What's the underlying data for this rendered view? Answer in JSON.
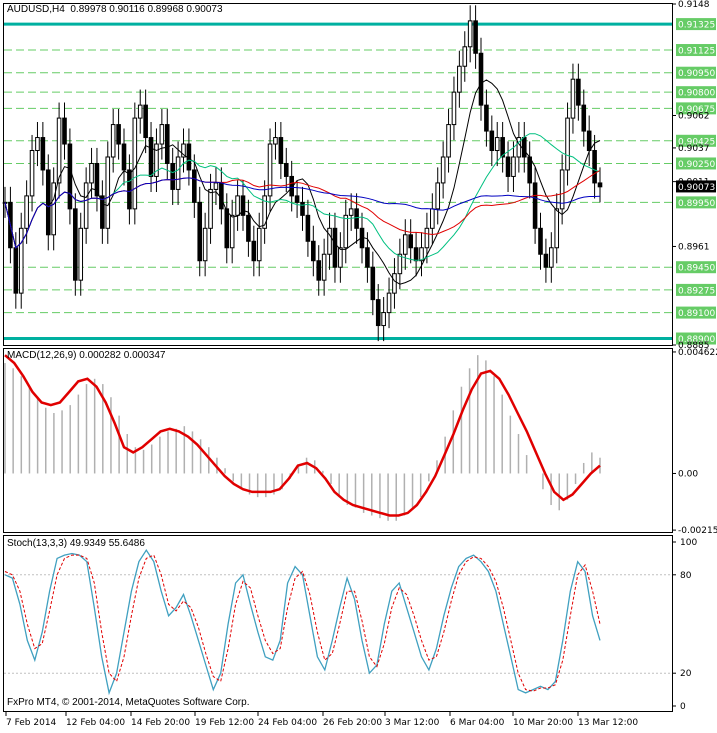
{
  "header": {
    "symbol": "AUDUSD,H4",
    "ohlc": "0.89978 0.90116 0.89968 0.90073"
  },
  "macd_header": "MACD(12,26,9) 0.000282 0.000347",
  "stoch_header": "Stoch(13,3,3) 49.9349 55.6486",
  "copyright": "FxPro MT4, © 2001-2014, MetaQuotes Software Corp.",
  "colors": {
    "up_candle": "#000000",
    "level_line": "#00b0a0",
    "fib_dash": "#66cc66",
    "sma_black": "#000000",
    "sma_green": "#00c080",
    "sma_red": "#e00000",
    "sma_blue": "#0000c0",
    "macd_signal": "#e00000",
    "macd_hist": "#b0b0b0",
    "stoch_main": "#40a0c0",
    "stoch_signal": "#e00000"
  },
  "chart_data": [
    {
      "type": "line",
      "name": "price",
      "title": "AUDUSD,H4",
      "ylim": [
        0.8885,
        0.9148
      ],
      "y_ticks": [
        "0.9148",
        "0.9062",
        "0.9037",
        "0.9011",
        "0.8961",
        "0.8885"
      ],
      "price_levels": [
        {
          "label": "0.91325",
          "value": 0.91325,
          "style": "solid"
        },
        {
          "label": "0.91125",
          "value": 0.91125,
          "style": "dash"
        },
        {
          "label": "0.90950",
          "value": 0.9095,
          "style": "dash"
        },
        {
          "label": "0.90800",
          "value": 0.908,
          "style": "dash"
        },
        {
          "label": "0.90675",
          "value": 0.90675,
          "style": "dash"
        },
        {
          "label": "0.90425",
          "value": 0.90425,
          "style": "dash"
        },
        {
          "label": "0.90250",
          "value": 0.9025,
          "style": "dash"
        },
        {
          "label": "0.89950",
          "value": 0.8995,
          "style": "dash"
        },
        {
          "label": "0.89450",
          "value": 0.8945,
          "style": "dash"
        },
        {
          "label": "0.89275",
          "value": 0.89275,
          "style": "dash"
        },
        {
          "label": "0.89100",
          "value": 0.891,
          "style": "dash"
        },
        {
          "label": "0.88900",
          "value": 0.889,
          "style": "solid"
        }
      ],
      "current_price": "0.90073",
      "x_labels": [
        "7 Feb 2014",
        "12 Feb 04:00",
        "14 Feb 20:00",
        "19 Feb 12:00",
        "24 Feb 04:00",
        "26 Feb 20:00",
        "3 Mar 12:00",
        "6 Mar 04:00",
        "10 Mar 20:00",
        "13 Mar 12:00"
      ],
      "close_series": [
        0.8995,
        0.896,
        0.8925,
        0.8975,
        0.9,
        0.9035,
        0.9045,
        0.902,
        0.897,
        0.901,
        0.906,
        0.904,
        0.899,
        0.8935,
        0.8975,
        0.901,
        0.9025,
        0.9,
        0.8975,
        0.903,
        0.9055,
        0.904,
        0.902,
        0.899,
        0.906,
        0.907,
        0.9045,
        0.9015,
        0.904,
        0.9055,
        0.9025,
        0.9005,
        0.903,
        0.904,
        0.902,
        0.8995,
        0.895,
        0.8975,
        0.9005,
        0.901,
        0.899,
        0.896,
        0.8985,
        0.9,
        0.8985,
        0.8965,
        0.895,
        0.8975,
        0.9,
        0.904,
        0.9045,
        0.9025,
        0.9015,
        0.9,
        0.8995,
        0.8985,
        0.8965,
        0.895,
        0.8935,
        0.8955,
        0.8975,
        0.8945,
        0.896,
        0.8985,
        0.899,
        0.8975,
        0.896,
        0.8945,
        0.892,
        0.89,
        0.891,
        0.8925,
        0.894,
        0.8955,
        0.897,
        0.896,
        0.895,
        0.896,
        0.8975,
        0.899,
        0.901,
        0.903,
        0.9055,
        0.908,
        0.91,
        0.9115,
        0.9135,
        0.911,
        0.907,
        0.905,
        0.9035,
        0.9045,
        0.903,
        0.9015,
        0.903,
        0.9045,
        0.903,
        0.901,
        0.8975,
        0.8955,
        0.8945,
        0.896,
        0.899,
        0.902,
        0.906,
        0.909,
        0.907,
        0.905,
        0.9035,
        0.901,
        0.9007
      ]
    },
    {
      "type": "bar",
      "name": "MACD(12,26,9)",
      "ylim": [
        -0.00215,
        0.00462
      ],
      "y_ticks": [
        "0.004622",
        "0.00",
        "-0.002154"
      ],
      "histogram": [
        0.0042,
        0.004,
        0.0037,
        0.0033,
        0.0029,
        0.0025,
        0.0023,
        0.0024,
        0.0026,
        0.003,
        0.0034,
        0.0036,
        0.0034,
        0.0029,
        0.0022,
        0.0015,
        0.001,
        0.0009,
        0.0011,
        0.0014,
        0.0016,
        0.0017,
        0.0018,
        0.0016,
        0.0013,
        0.001,
        0.0006,
        0.0002,
        -0.0003,
        -0.0006,
        -0.0008,
        -0.0009,
        -0.0009,
        -0.0008,
        -0.0006,
        -0.0002,
        0.0003,
        0.0006,
        0.0005,
        0.0001,
        -0.0004,
        -0.0009,
        -0.0012,
        -0.0013,
        -0.0015,
        -0.0016,
        -0.0017,
        -0.0018,
        -0.0018,
        -0.0016,
        -0.0013,
        -0.0009,
        -0.0003,
        0.0005,
        0.0014,
        0.0024,
        0.0033,
        0.004,
        0.0045,
        0.0043,
        0.0037,
        0.003,
        0.0022,
        0.0015,
        0.0007,
        0.0,
        -0.0006,
        -0.0012,
        -0.0014,
        -0.001,
        -0.0004,
        0.0004,
        0.0008,
        0.0006
      ],
      "signal": [
        0.0045,
        0.0042,
        0.0037,
        0.0031,
        0.0027,
        0.0026,
        0.0027,
        0.0031,
        0.0035,
        0.0036,
        0.0033,
        0.0027,
        0.0019,
        0.001,
        0.0008,
        0.001,
        0.0013,
        0.0016,
        0.0017,
        0.0016,
        0.0014,
        0.0011,
        0.0007,
        0.0003,
        -0.0001,
        -0.0004,
        -0.0006,
        -0.0007,
        -0.0007,
        -0.0007,
        -0.0006,
        -0.0002,
        0.0003,
        0.0004,
        0.0002,
        -0.0002,
        -0.0007,
        -0.001,
        -0.0012,
        -0.0013,
        -0.0014,
        -0.0015,
        -0.0016,
        -0.0016,
        -0.0015,
        -0.0012,
        -0.0007,
        -0.0001,
        0.0007,
        0.0015,
        0.0024,
        0.0032,
        0.0038,
        0.0039,
        0.0036,
        0.003,
        0.0023,
        0.0016,
        0.0008,
        0.0,
        -0.0007,
        -0.001,
        -0.0008,
        -0.0004,
        0.0,
        0.0003
      ]
    },
    {
      "type": "line",
      "name": "Stoch(13,3,3)",
      "ylim": [
        0,
        100
      ],
      "y_ticks": [
        "100",
        "80",
        "20",
        "0"
      ],
      "main": [
        80,
        78,
        62,
        40,
        28,
        45,
        70,
        90,
        92,
        93,
        92,
        88,
        60,
        30,
        8,
        20,
        45,
        70,
        88,
        95,
        88,
        70,
        55,
        60,
        68,
        55,
        40,
        25,
        10,
        20,
        50,
        75,
        80,
        62,
        45,
        30,
        28,
        40,
        75,
        85,
        80,
        55,
        30,
        22,
        40,
        60,
        78,
        65,
        40,
        20,
        25,
        50,
        70,
        75,
        60,
        45,
        30,
        22,
        35,
        55,
        72,
        85,
        90,
        92,
        88,
        82,
        70,
        50,
        30,
        10,
        8,
        10,
        12,
        10,
        15,
        40,
        70,
        88,
        82,
        55,
        40
      ],
      "signal": [
        82,
        80,
        70,
        50,
        35,
        38,
        58,
        80,
        90,
        92,
        92,
        90,
        75,
        45,
        20,
        15,
        30,
        55,
        78,
        90,
        92,
        80,
        62,
        58,
        64,
        60,
        48,
        32,
        18,
        15,
        35,
        62,
        76,
        72,
        55,
        40,
        32,
        35,
        60,
        78,
        82,
        68,
        45,
        28,
        32,
        50,
        70,
        70,
        52,
        30,
        24,
        38,
        60,
        72,
        68,
        55,
        40,
        28,
        30,
        45,
        64,
        80,
        88,
        91,
        90,
        85,
        76,
        60,
        40,
        20,
        10,
        9,
        11,
        11,
        13,
        28,
        55,
        80,
        86,
        70,
        50
      ]
    }
  ]
}
